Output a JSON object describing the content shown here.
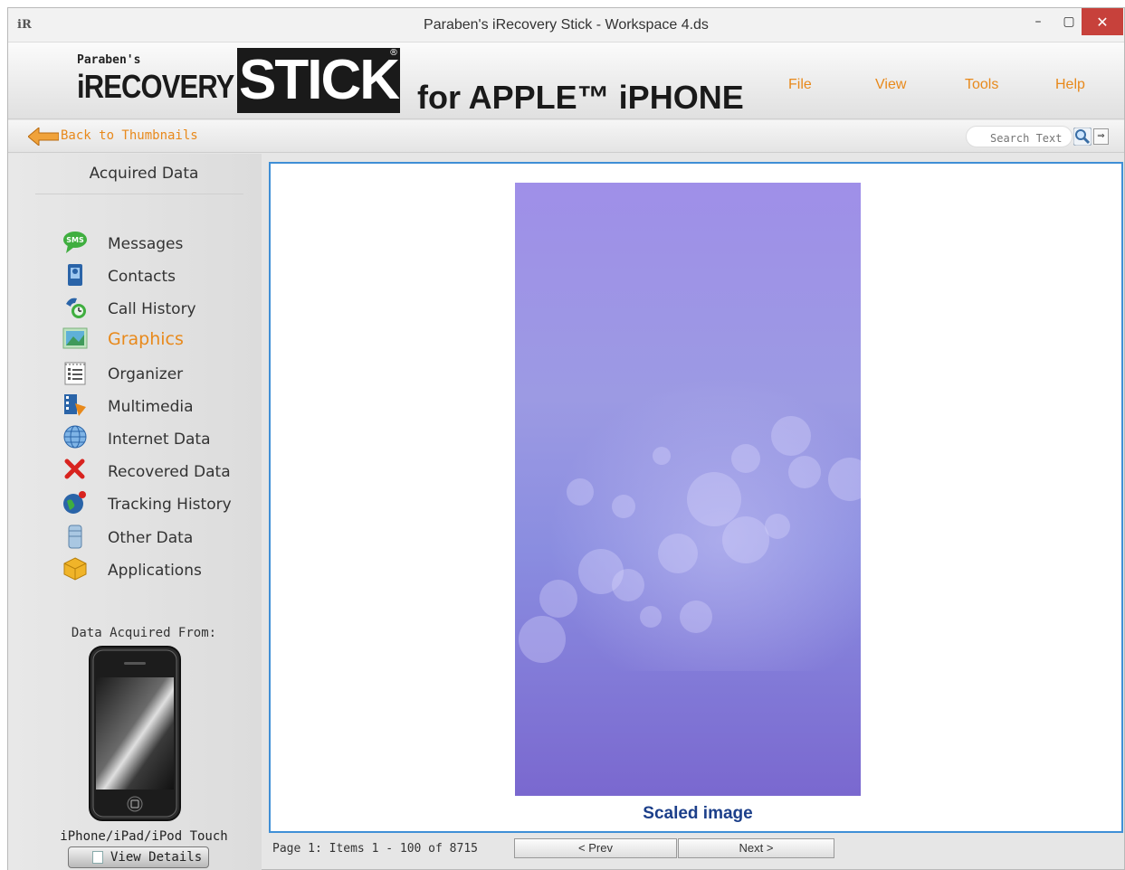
{
  "window": {
    "app_icon": "iR",
    "title": "Paraben's iRecovery Stick - Workspace 4.ds",
    "minimize_label": "–",
    "maximize_label": "▢",
    "close_label": "✕"
  },
  "brand": {
    "parabens": "Paraben's",
    "irecovery": "iRECOVERY",
    "stick": "STICK",
    "registered": "®",
    "for_apple": "for APPLE™ iPHONE"
  },
  "menu": {
    "file": "File",
    "view": "View",
    "tools": "Tools",
    "help": "Help"
  },
  "nav": {
    "back_label": "Back to Thumbnails",
    "search_placeholder": "Search Text",
    "search_go": "⇒"
  },
  "sidebar": {
    "title": "Acquired Data",
    "items": [
      {
        "label": "Messages",
        "icon": "sms-icon"
      },
      {
        "label": "Contacts",
        "icon": "contacts-book-icon"
      },
      {
        "label": "Call History",
        "icon": "phone-clock-icon"
      },
      {
        "label": "Graphics",
        "icon": "picture-icon",
        "active": true
      },
      {
        "label": "Organizer",
        "icon": "checklist-icon"
      },
      {
        "label": "Multimedia",
        "icon": "film-music-icon"
      },
      {
        "label": "Internet Data",
        "icon": "globe-icon"
      },
      {
        "label": "Recovered Data",
        "icon": "red-x-icon"
      },
      {
        "label": "Tracking History",
        "icon": "world-pin-icon"
      },
      {
        "label": "Other Data",
        "icon": "database-icon"
      },
      {
        "label": "Applications",
        "icon": "package-icon"
      }
    ],
    "acquired_from": "Data Acquired From:",
    "device_label": "iPhone/iPad/iPod Touch",
    "view_details": "View Details"
  },
  "viewer": {
    "caption": "Scaled image"
  },
  "footer": {
    "page_info": "Page 1: Items 1 - 100 of 8715",
    "prev": "< Prev",
    "next": "Next >"
  },
  "colors": {
    "accent_orange": "#e8891b",
    "viewer_border": "#3f8fd6",
    "caption_blue": "#1c3f8a",
    "close_red": "#c7413b"
  }
}
